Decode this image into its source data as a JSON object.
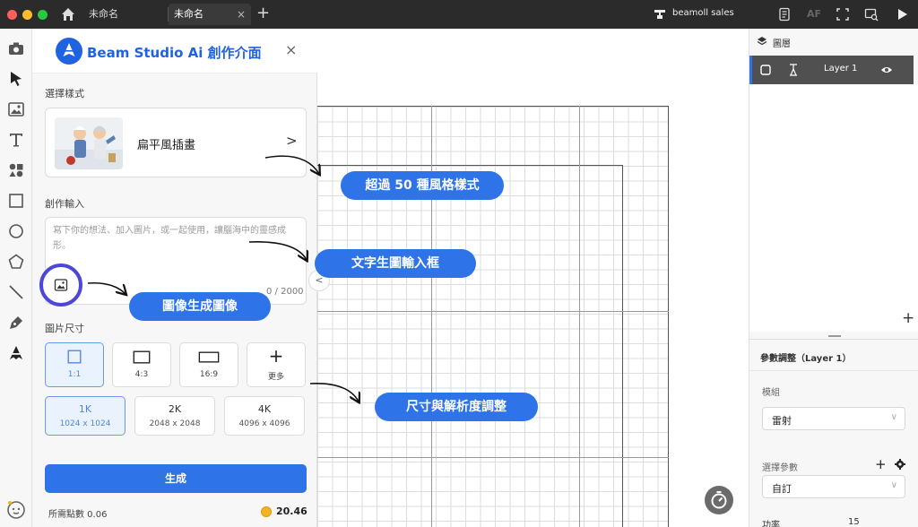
{
  "titlebar": {
    "tabs": [
      {
        "label": "未命名"
      },
      {
        "label": "未命名"
      }
    ],
    "close_glyph": "×",
    "new_tab_glyph": "+",
    "user_name": "beamoll sales",
    "af_label": "AF",
    "icons": [
      "home-icon",
      "user-icon",
      "document-icon",
      "frame-icon",
      "image-search-icon",
      "play-icon"
    ],
    "traffic_lights": [
      "#ff5f57",
      "#febc2e",
      "#28c840"
    ]
  },
  "toolbar": {
    "tools": [
      "camera-icon",
      "cursor-icon",
      "image-icon",
      "text-icon",
      "shapes-icon",
      "rectangle-icon",
      "circle-icon",
      "polygon-icon",
      "line-icon",
      "pen-icon",
      "beam-ai-icon"
    ]
  },
  "panel": {
    "title": "Beam Studio Ai 創作介面",
    "close_glyph": "×",
    "style_section_label": "選擇樣式",
    "style_name": "扁平風插畫",
    "style_chevron": ">",
    "input_section_label": "創作輸入",
    "prompt_placeholder": "寫下你的想法、加入圖片，或一起使用，讓腦海中的靈感成形。",
    "counter": "0 / 2000",
    "collapse_glyph": "<",
    "size_section_label": "圖片尺寸",
    "sizes": [
      {
        "label": "1:1",
        "selected": true
      },
      {
        "label": "4:3",
        "selected": false
      },
      {
        "label": "16:9",
        "selected": false
      },
      {
        "label": "更多",
        "selected": false
      }
    ],
    "more_glyph": "+",
    "resolutions": [
      {
        "label": "1K",
        "dims": "1024 x 1024",
        "selected": true
      },
      {
        "label": "2K",
        "dims": "2048 x 2048",
        "selected": false
      },
      {
        "label": "4K",
        "dims": "4096 x 4096",
        "selected": false
      }
    ],
    "generate_label": "生成",
    "points_label": "所需點數 0.06",
    "balance": "20.46",
    "accent_color": "#2e73e8"
  },
  "callouts": {
    "styles": "超過 50 種風格樣式",
    "text_input": "文字生圖輸入框",
    "image_to_image": "圖像生成圖像",
    "size_resolution": "尺寸與解析度調整"
  },
  "right_panel": {
    "layers_title": "圖層",
    "layer_name": "Layer 1",
    "add_glyph": "+",
    "param_title": "參數調整（Layer 1）",
    "module_label": "模組",
    "module_value": "雷射",
    "select_param_label": "選擇參數",
    "select_param_value": "自訂",
    "power_label": "功率",
    "power_value": "15",
    "dropdown_glyph": "∨"
  }
}
